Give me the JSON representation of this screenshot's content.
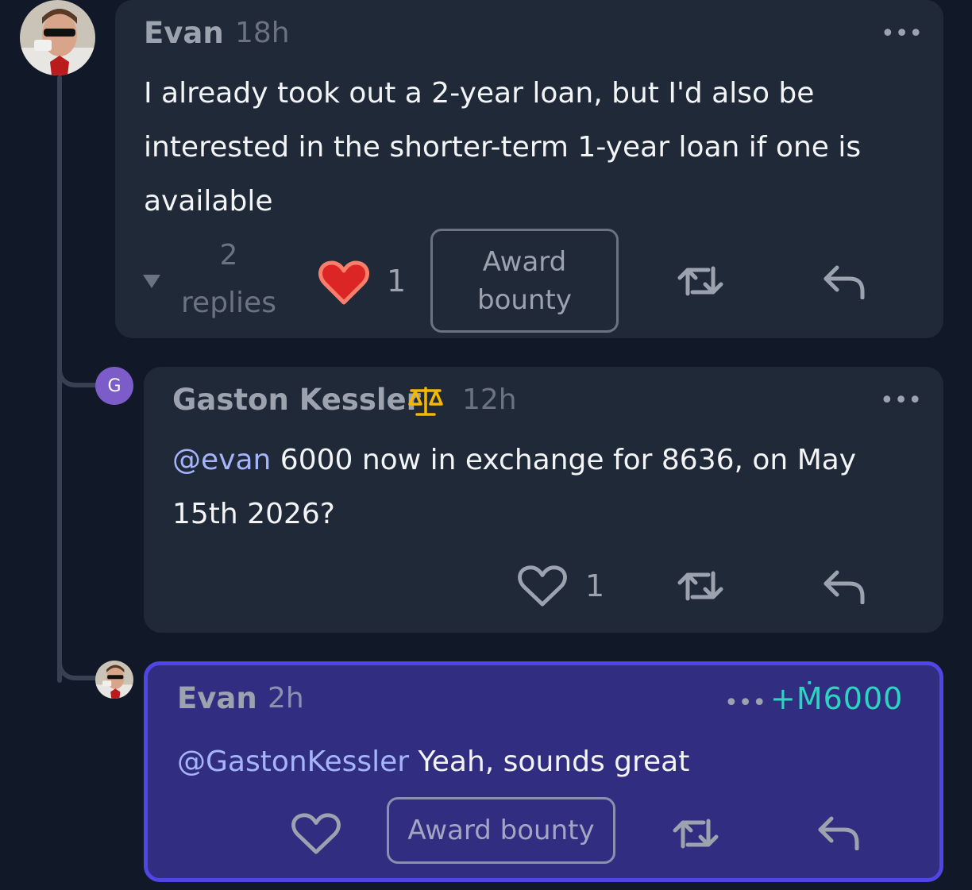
{
  "comments": [
    {
      "author": "Evan",
      "time": "18h",
      "text": "I already took out a 2-year loan, but I'd also be interested in the shorter-term 1-year loan if one is available",
      "replies_count": "2",
      "replies_label": "replies",
      "likes": "1",
      "award_label": "Award bounty",
      "liked": true
    },
    {
      "author": "Gaston Kessler",
      "avatar_letter": "G",
      "time": "12h",
      "mention": "@evan",
      "text": " 6000 now in exchange for 8636, on May 15th 2026?",
      "likes": "1"
    },
    {
      "author": "Evan",
      "time": "2h",
      "mention": "@GastonKessler",
      "text": " Yeah, sounds great",
      "tip": "+Ṁ6000",
      "award_label": "Award bounty"
    }
  ],
  "menu_glyph": "•••",
  "colors": {
    "background": "#111827",
    "card": "#1f2937",
    "highlight_card": "#312e81",
    "highlight_border": "#4f46e5",
    "mention": "#a5b4fc",
    "tip": "#2dd4bf",
    "heart_fill": "#dc2626"
  }
}
